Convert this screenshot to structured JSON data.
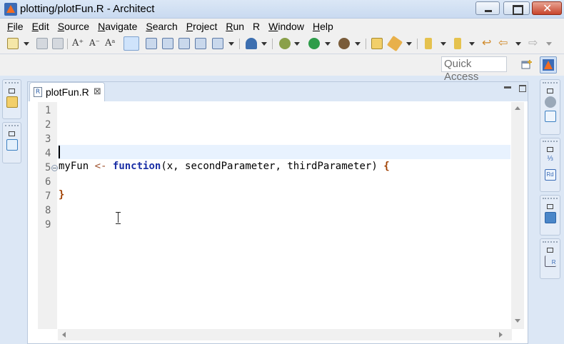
{
  "window": {
    "title": "plotting/plotFun.R - Architect"
  },
  "menu": [
    "File",
    "Edit",
    "Source",
    "Navigate",
    "Search",
    "Project",
    "Run",
    "R",
    "Window",
    "Help"
  ],
  "quick_access": {
    "placeholder": "Quick Access"
  },
  "editor": {
    "tab_label": "plotFun.R",
    "tab_close": "⊠",
    "tab_icon_letter": "R",
    "line_numbers": [
      "1",
      "2",
      "3",
      "4",
      "5",
      "6",
      "7",
      "8",
      "9"
    ],
    "code": {
      "l5_name": "myFun",
      "l5_assign": "<-",
      "l5_keyword": "function",
      "l5_args": "(x, secondParameter, thirdParameter)",
      "l5_open": "{",
      "l7_close": "}"
    },
    "current_line": 4,
    "folded_line": 5
  },
  "colors": {
    "accent": "#3b6cb7",
    "keyword": "#1a2fa6",
    "brace": "#a04000"
  }
}
